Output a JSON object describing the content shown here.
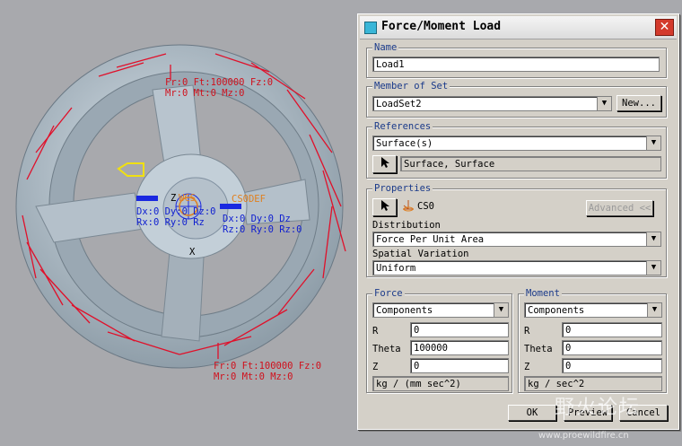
{
  "viewport": {
    "labels": {
      "top_force_line1": "Fr:0 Ft:100000 Fz:0",
      "top_force_line2": "Mr:0 Mt:0 Mz:0",
      "bottom_force_line1": "Fr:0 Ft:100000 Fz:0",
      "bottom_force_line2": "Mr:0 Mt:0 Mz:0",
      "center_line1": "Dx:0 Dy:0 Dz:0",
      "center_line2": "Rx:0 Ry:0 Rz",
      "center_line3": "Dx:0 Dy:0 Dz",
      "center_line4": "Rz:0 Ry:0 Rz:0",
      "csys_label": "WCS",
      "csys_def": "CS0DEF",
      "axis_z": "Z",
      "axis_x": "X"
    }
  },
  "dialog": {
    "title": "Force/Moment Load",
    "close_glyph": "✕",
    "name": {
      "label": "Name",
      "value": "Load1"
    },
    "member_of_set": {
      "label": "Member of Set",
      "value": "LoadSet2",
      "new_button": "New..."
    },
    "references": {
      "label": "References",
      "type": "Surface(s)",
      "selection": "Surface, Surface"
    },
    "properties": {
      "label": "Properties",
      "csys": "CS0",
      "advanced_button": "Advanced <<",
      "distribution_label": "Distribution",
      "distribution_value": "Force Per Unit Area",
      "spatial_label": "Spatial Variation",
      "spatial_value": "Uniform"
    },
    "force": {
      "label": "Force",
      "mode": "Components",
      "r_label": "R",
      "r_value": "0",
      "theta_label": "Theta",
      "theta_value": "100000",
      "z_label": "Z",
      "z_value": "0",
      "units": "kg / (mm sec^2)"
    },
    "moment": {
      "label": "Moment",
      "mode": "Components",
      "r_label": "R",
      "r_value": "0",
      "theta_label": "Theta",
      "theta_value": "0",
      "z_label": "Z",
      "z_value": "0",
      "units": "kg / sec^2"
    },
    "buttons": {
      "ok": "OK",
      "preview": "Preview",
      "cancel": "Cancel"
    }
  },
  "watermark": {
    "cn": "野火论坛",
    "url": "www.proewildfire.cn"
  },
  "colors": {
    "load_arrow": "#e0102a",
    "constraint": "#1a28e0",
    "part": "#b8c6d2",
    "accent": "#39b6d8"
  }
}
